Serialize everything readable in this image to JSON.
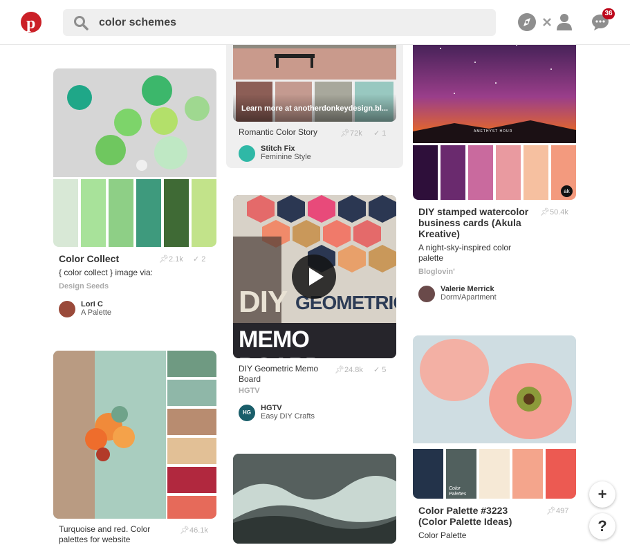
{
  "search": {
    "value": "color schemes"
  },
  "notifications": {
    "count": "36"
  },
  "icons": {
    "logo": "pinterest-logo",
    "search": "search-icon",
    "clear": "close-icon",
    "explore": "compass-icon",
    "profile": "person-icon",
    "messages": "chat-icon"
  },
  "pins": [
    {
      "title": "Color Collect",
      "repins": "2.1k",
      "likes": "2",
      "desc": "{ color collect } image via:",
      "source": "Design Seeds",
      "user": "Lori C",
      "board": "A Palette",
      "colors": [
        "#d8e8d6",
        "#a8e29a",
        "#8ecf86",
        "#3e9a7d",
        "#3f6a35",
        "#c2e38a"
      ]
    },
    {
      "title": "Romantic Color Story",
      "repins": "72k",
      "likes": "1",
      "overlay": "Learn more at anotherdonkeydesign.bl...",
      "user": "Stitch Fix",
      "board": "Feminine Style",
      "colors": [
        "#8c5e56",
        "#c49a90",
        "#a8a89c",
        "#98c8c0"
      ]
    },
    {
      "title": "DIY Geometric Memo Board",
      "repins": "24.8k",
      "likes": "5",
      "source": "HGTV",
      "user": "HGTV",
      "board": "Easy DIY Crafts",
      "overlay1": "DIY",
      "overlay2": "GEOMETRIC",
      "overlay3": "MEMO BOARD"
    },
    {
      "title": "DIY stamped watercolor business cards (Akula Kreative)",
      "repins": "50.4k",
      "desc": "A night-sky-inspired color palette",
      "source": "Bloglovin'",
      "user": "Valerie Merrick",
      "board": "Dorm/Apartment",
      "caption": "AMETHYST HOUR",
      "colors": [
        "#2e0f3a",
        "#6a2a6e",
        "#c96a9e",
        "#e99aa0",
        "#f6c0a0",
        "#f39a7e"
      ]
    },
    {
      "title": "Turquoise and red. Color palettes for website",
      "repins": "46.1k",
      "colors": [
        "#6f9a82",
        "#8fb7a8",
        "#b88c70",
        "#e2c096",
        "#b1283e",
        "#e66a5a"
      ]
    },
    {
      "title": "Color Palette #3223 (Color Palette Ideas)",
      "repins": "497",
      "desc": "Color Palette",
      "colors": [
        "#23334a",
        "#51605e",
        "#f6e9d6",
        "#f4a58c",
        "#ec5a52"
      ],
      "stamp": "Color Palettes"
    }
  ],
  "buttons": {
    "add": "+",
    "help": "?"
  }
}
